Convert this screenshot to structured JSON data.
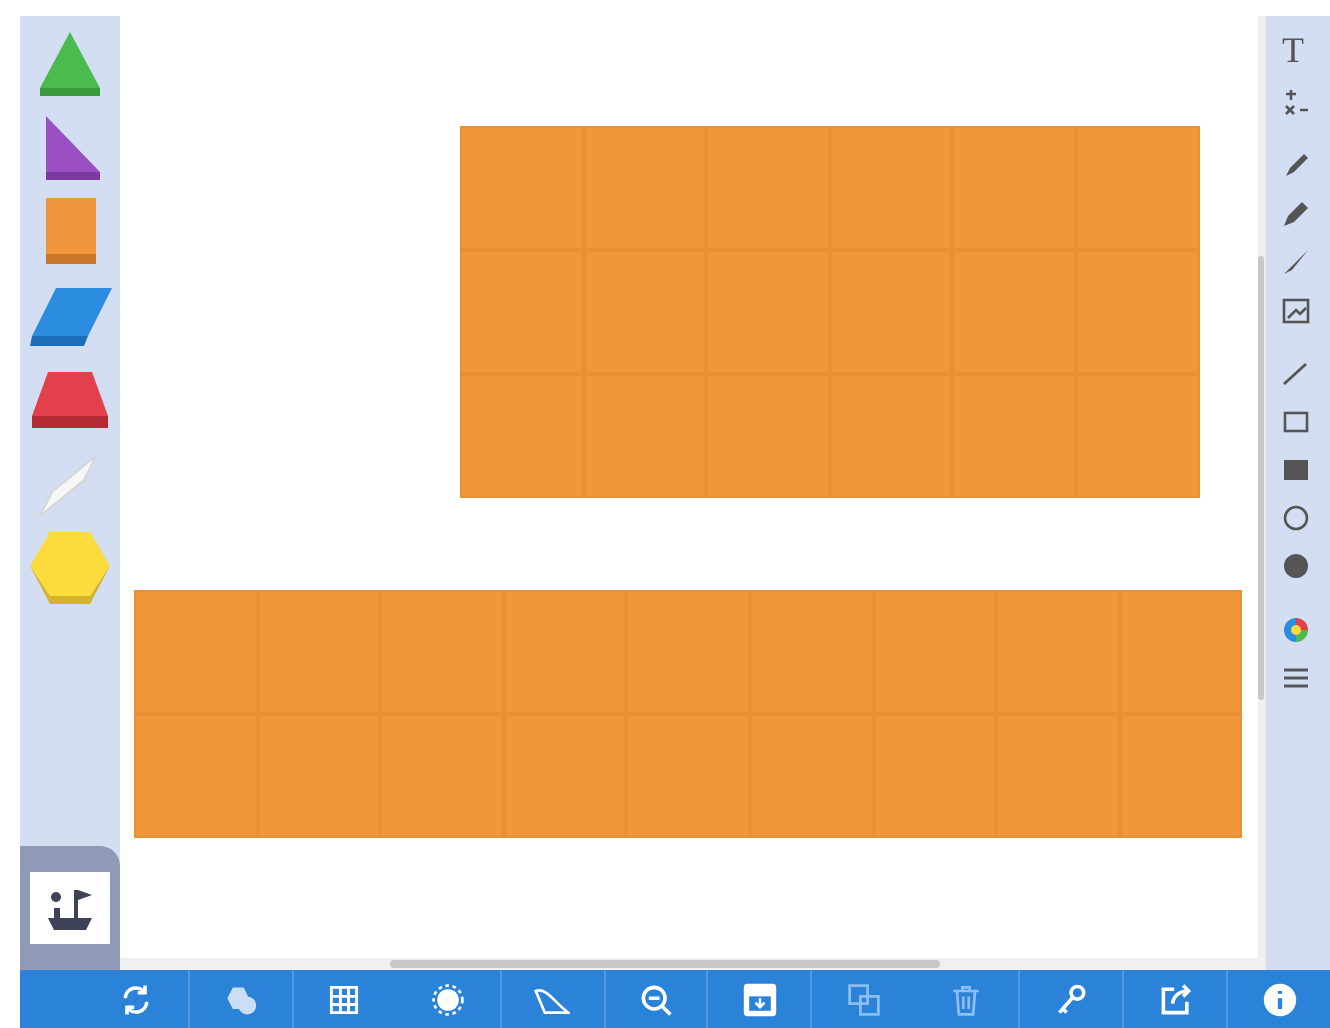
{
  "shape_palette": [
    {
      "kind": "triangle",
      "color": "#4cbb4f"
    },
    {
      "kind": "right-triangle",
      "color": "#9b4fc4"
    },
    {
      "kind": "square",
      "color": "#f0963c"
    },
    {
      "kind": "rhombus",
      "color": "#2b8de0"
    },
    {
      "kind": "trapezoid",
      "color": "#e2404a"
    },
    {
      "kind": "thin-rhombus",
      "color": "#f7f7f7"
    },
    {
      "kind": "hexagon",
      "color": "#fbdc3c"
    }
  ],
  "right_toolbar": {
    "text_tool": "T",
    "tools": [
      {
        "kind": "formula"
      },
      {
        "kind": "pen"
      },
      {
        "kind": "marker"
      },
      {
        "kind": "brush"
      },
      {
        "kind": "image"
      },
      {
        "kind": "line"
      },
      {
        "kind": "rect-outline"
      },
      {
        "kind": "rect-filled"
      },
      {
        "kind": "circle-outline"
      },
      {
        "kind": "circle-filled"
      },
      {
        "kind": "palette"
      },
      {
        "kind": "menu"
      }
    ]
  },
  "bottom_toolbar": [
    {
      "kind": "refresh",
      "disabled": false
    },
    {
      "kind": "shapes",
      "disabled": false
    },
    {
      "kind": "grid",
      "disabled": false
    },
    {
      "kind": "sun",
      "disabled": false
    },
    {
      "kind": "curve",
      "disabled": false
    },
    {
      "kind": "zoom-out",
      "disabled": false
    },
    {
      "kind": "save",
      "disabled": false
    },
    {
      "kind": "copy",
      "disabled": true
    },
    {
      "kind": "delete",
      "disabled": true
    },
    {
      "kind": "key",
      "disabled": false
    },
    {
      "kind": "share",
      "disabled": false
    },
    {
      "kind": "info",
      "disabled": false
    }
  ]
}
